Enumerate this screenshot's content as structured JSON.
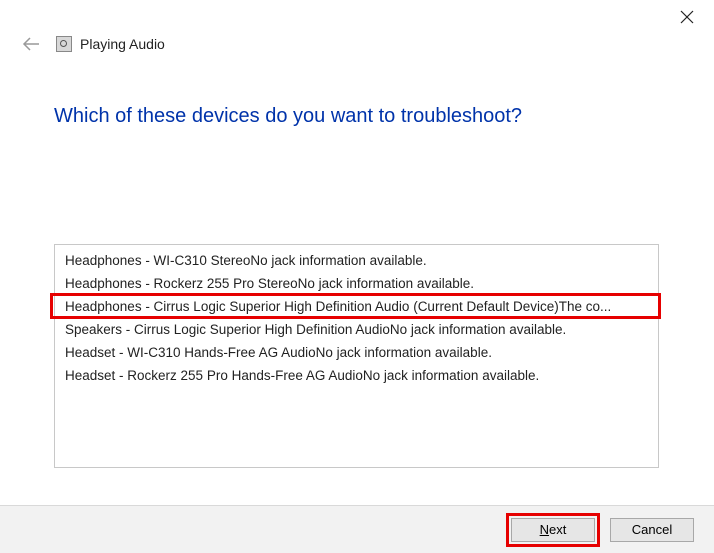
{
  "titlebar": {
    "troubleshooter_name": "Playing Audio"
  },
  "heading": "Which of these devices do you want to troubleshoot?",
  "devices": [
    "Headphones - WI-C310 StereoNo jack information available.",
    "Headphones - Rockerz 255 Pro StereoNo jack information available.",
    "Headphones - Cirrus Logic Superior High Definition Audio (Current Default Device)The co...",
    "Speakers - Cirrus Logic Superior High Definition AudioNo jack information available.",
    "Headset - WI-C310 Hands-Free AG AudioNo jack information available.",
    "Headset - Rockerz 255 Pro Hands-Free AG AudioNo jack information available."
  ],
  "buttons": {
    "next_prefix": "N",
    "next_rest": "ext",
    "cancel": "Cancel"
  }
}
